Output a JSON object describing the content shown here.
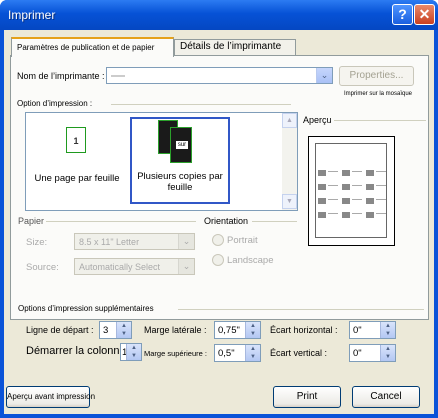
{
  "window": {
    "title": "Imprimer"
  },
  "tabs": [
    {
      "label": "Paramètres de publication et de papier"
    },
    {
      "label": "Détails de l’imprimante"
    }
  ],
  "printer": {
    "name_label": "Nom de l’imprimante :",
    "properties_label": "Properties...",
    "mosaic_label": "Imprimer sur la mosaïque"
  },
  "print_options": {
    "label": "Option d’impression :",
    "items": [
      {
        "label": "Une page par feuille",
        "page_number": "1"
      },
      {
        "label": "Plusieurs copies par feuille",
        "badge": "sur"
      }
    ]
  },
  "preview": {
    "label": "Aperçu"
  },
  "paper": {
    "label": "Papier",
    "size_label": "Size:",
    "size_value": "8.5 x 11\" Letter",
    "source_label": "Source:",
    "source_value": "Automatically Select"
  },
  "orientation": {
    "label": "Orientation",
    "portrait": "Portrait",
    "landscape": "Landscape"
  },
  "extra": {
    "label": "Options d’impression supplémentaires",
    "start_row_label": "Ligne de départ :",
    "start_row_value": "3",
    "start_col_label": "Démarrer la colonne :",
    "start_col_value": "1",
    "side_margin_label": "Marge latérale :",
    "side_margin_value": "0,75\"",
    "top_margin_label": "Marge supérieure :",
    "top_margin_value": "0,5\"",
    "hgap_label": "Écart horizontal :",
    "hgap_value": "0\"",
    "vgap_label": "Écart vertical :",
    "vgap_value": "0\""
  },
  "footer": {
    "preview_button": "Aperçu avant impression",
    "print_button": "Print",
    "cancel_button": "Cancel"
  }
}
